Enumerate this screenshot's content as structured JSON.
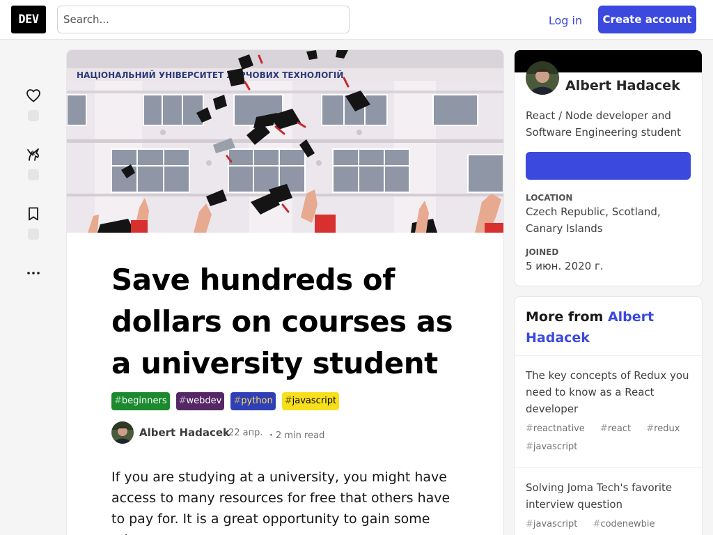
{
  "header": {
    "logo_text": "DEV",
    "search_placeholder": "Search...",
    "login_label": "Log in",
    "create_account_label": "Create account",
    "accent_color": "#3b49df"
  },
  "rail": {
    "icons": [
      "heart-icon",
      "unicorn-icon",
      "bookmark-icon",
      "more-horizontal-icon"
    ]
  },
  "article": {
    "cover_alt": "Graduation caps thrown in the air in front of a university building",
    "cover_building_sign": "НАЦІОНАЛЬНИЙ УНІВЕРСИТЕТ ХАРЧОВИХ ТЕХНОЛОГІЙ",
    "title": "Save hundreds of dollars on courses as a university student",
    "tags": [
      {
        "hash": "#",
        "name": "beginners",
        "color": "#1b8a2e",
        "text_color": "#ffffff"
      },
      {
        "hash": "#",
        "name": "webdev",
        "color": "#562765",
        "text_color": "#ffffff"
      },
      {
        "hash": "#",
        "name": "python",
        "color": "#2f3fb6",
        "text_color": "#ffdf5b"
      },
      {
        "hash": "#",
        "name": "javascript",
        "color": "#f7df1e",
        "text_color": "#000000"
      }
    ],
    "author_name": "Albert Hadacek",
    "date": "22 апр.",
    "read_time": "・2 min read",
    "body": "If you are studying at a university, you might have access to many resources for free that others have to pay for. It is a great opportunity to gain some edge,"
  },
  "profile": {
    "name": "Albert Hadacek",
    "bio": "React / Node developer and Software Engineering student",
    "location_label": "LOCATION",
    "location_value": "Czech Republic, Scotland, Canary Islands",
    "joined_label": "JOINED",
    "joined_value": "5 июн. 2020 г."
  },
  "more_from": {
    "prefix": "More from ",
    "author": "Albert Hadacek",
    "posts": [
      {
        "title": "The key concepts of Redux you need to know as a React developer",
        "tags": [
          "reactnative",
          "react",
          "redux",
          "javascript"
        ]
      },
      {
        "title": "Solving Joma Tech's favorite interview question",
        "tags": [
          "javascript",
          "codenewbie"
        ]
      }
    ]
  }
}
